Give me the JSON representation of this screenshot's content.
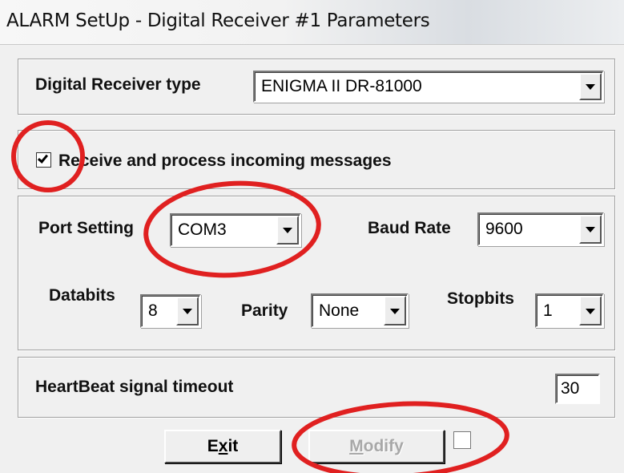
{
  "window": {
    "title": "ALARM SetUp - Digital Receiver #1 Parameters"
  },
  "receiver": {
    "type_label": "Digital Receiver type",
    "type_value": "ENIGMA II DR-81000"
  },
  "process": {
    "label": "Receive and process incoming messages",
    "checked": true
  },
  "port": {
    "port_label": "Port Setting",
    "port_value": "COM3",
    "baud_label": "Baud Rate",
    "baud_value": "9600",
    "databits_label": "Databits",
    "databits_value": "8",
    "parity_label": "Parity",
    "parity_value": "None",
    "stopbits_label": "Stopbits",
    "stopbits_value": "1"
  },
  "heartbeat": {
    "label": "HeartBeat signal timeout",
    "value": "30"
  },
  "buttons": {
    "exit_pre": "E",
    "exit_mnemonic": "x",
    "exit_post": "it",
    "modify_mnemonic": "M",
    "modify_post": "odify",
    "modify_enabled": false,
    "side_checkbox_checked": false
  },
  "annotations": {
    "color": "#e02020"
  }
}
